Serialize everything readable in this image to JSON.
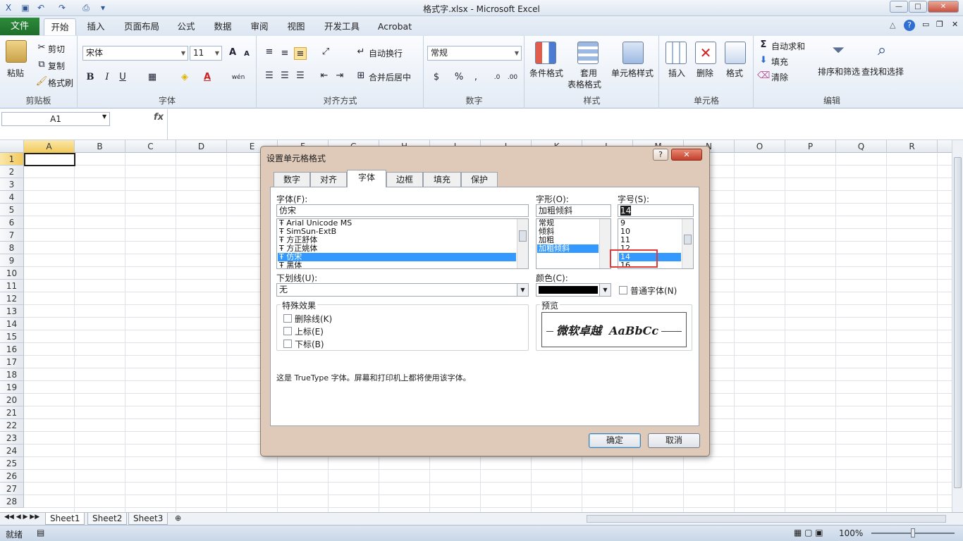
{
  "window": {
    "title": "格式字.xlsx - Microsoft Excel",
    "min": "—",
    "max": "□",
    "close": "✕"
  },
  "ribbon_tabs": [
    "文件",
    "开始",
    "插入",
    "页面布局",
    "公式",
    "数据",
    "审阅",
    "视图",
    "开发工具",
    "Acrobat"
  ],
  "clipboard": {
    "paste": "粘贴",
    "cut": "剪切",
    "copy": "复制",
    "format_painter": "格式刷",
    "label": "剪贴板"
  },
  "font_group": {
    "font_name": "宋体",
    "font_size": "11",
    "label": "字体",
    "bold": "B",
    "italic": "I",
    "underline": "U",
    "grow": "A",
    "shrink": "A",
    "phonetic": "wén"
  },
  "alignment_group": {
    "wrap": "自动换行",
    "merge": "合并后居中",
    "label": "对齐方式"
  },
  "number_group": {
    "format": "常规",
    "percent": "%",
    "comma": ",",
    "label": "数字"
  },
  "styles_group": {
    "conditional": "条件格式",
    "table_a": "套用",
    "table_b": "表格格式",
    "cell_styles": "单元格样式",
    "label": "样式"
  },
  "cells_group": {
    "insert": "插入",
    "delete": "删除",
    "format": "格式",
    "label": "单元格"
  },
  "editing_group": {
    "autosum": "自动求和",
    "fill": "填充",
    "clear": "清除",
    "sort": "排序和筛选",
    "find": "查找和选择",
    "label": "编辑"
  },
  "formula_bar": {
    "name_box": "A1",
    "fx": "fx"
  },
  "columns": [
    "A",
    "B",
    "C",
    "D",
    "E",
    "F",
    "G",
    "H",
    "I",
    "J",
    "K",
    "L",
    "M",
    "N",
    "O",
    "P",
    "Q",
    "R"
  ],
  "rows": [
    "1",
    "2",
    "3",
    "4",
    "5",
    "6",
    "7",
    "8",
    "9",
    "10",
    "11",
    "12",
    "13",
    "14",
    "15",
    "16",
    "17",
    "18",
    "19",
    "20",
    "21",
    "22",
    "23",
    "24",
    "25",
    "26",
    "27",
    "28"
  ],
  "sheets": [
    "Sheet1",
    "Sheet2",
    "Sheet3"
  ],
  "status": {
    "ready": "就绪",
    "zoom": "100%"
  },
  "dialog": {
    "title": "设置单元格格式",
    "help": "?",
    "close": "✕",
    "tabs": [
      "数字",
      "对齐",
      "字体",
      "边框",
      "填充",
      "保护"
    ],
    "font_label": "字体(F):",
    "font_value": "仿宋",
    "font_list": [
      "Arial Unicode MS",
      "SimSun-ExtB",
      "方正舒体",
      "方正姚体",
      "仿宋",
      "黑体"
    ],
    "style_label": "字形(O):",
    "style_value": "加粗倾斜",
    "style_list": [
      "常规",
      "倾斜",
      "加粗",
      "加粗倾斜"
    ],
    "size_label": "字号(S):",
    "size_value": "14",
    "size_list": [
      "9",
      "10",
      "11",
      "12",
      "14",
      "16"
    ],
    "underline_label": "下划线(U):",
    "underline_value": "无",
    "color_label": "颜色(C):",
    "color_value": "#000000",
    "normal_font": "普通字体(N)",
    "effects_label": "特殊效果",
    "strikethrough": "删除线(K)",
    "superscript": "上标(E)",
    "subscript": "下标(B)",
    "preview_label": "预览",
    "preview_text": "微软卓越  AaBbCc",
    "info": "这是 TrueType 字体。屏幕和打印机上都将使用该字体。",
    "ok": "确定",
    "cancel": "取消"
  }
}
